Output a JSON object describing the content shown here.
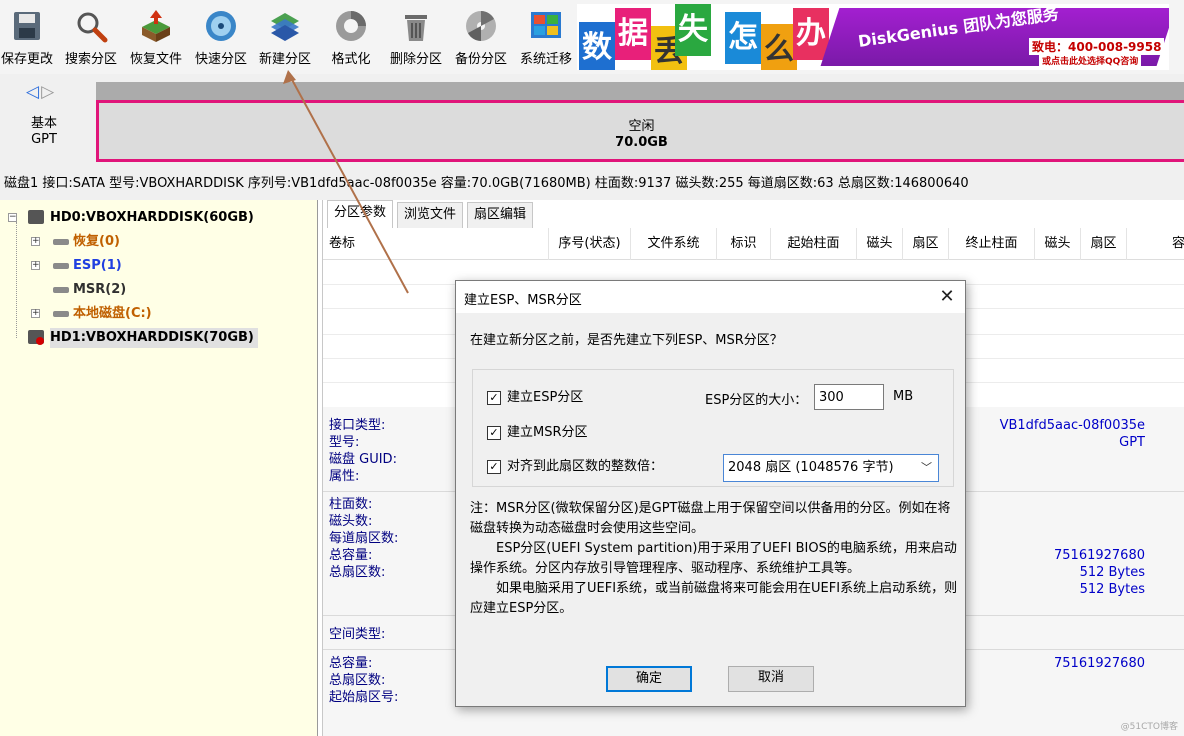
{
  "toolbar": {
    "buttons": [
      {
        "label": "保存更改",
        "icon": "save-icon"
      },
      {
        "label": "搜索分区",
        "icon": "search-icon"
      },
      {
        "label": "恢复文件",
        "icon": "recover-file-icon"
      },
      {
        "label": "快速分区",
        "icon": "quick-partition-icon"
      },
      {
        "label": "新建分区",
        "icon": "new-partition-icon"
      },
      {
        "label": "格式化",
        "icon": "format-icon"
      },
      {
        "label": "删除分区",
        "icon": "delete-partition-icon"
      },
      {
        "label": "备份分区",
        "icon": "backup-partition-icon"
      },
      {
        "label": "系统迁移",
        "icon": "system-migrate-icon"
      }
    ]
  },
  "banner": {
    "chars": [
      "数",
      "据",
      "丢",
      "失",
      "怎",
      "么",
      "办"
    ],
    "brand": "DiskGenius 团队为您服务",
    "phone": "致电：400-008-9958",
    "qq": "或点击此处选择QQ咨询"
  },
  "disk_map": {
    "type_label": "基本",
    "style_label": "GPT",
    "free_label": "空闲",
    "free_size": "70.0GB"
  },
  "disk_info": "磁盘1 接口:SATA  型号:VBOXHARDDISK  序列号:VB1dfd5aac-08f0035e  容量:70.0GB(71680MB)  柱面数:9137  磁头数:255  每道扇区数:63  总扇区数:146800640",
  "tree": {
    "disk0": "HD0:VBOXHARDDISK(60GB)",
    "partitions": [
      {
        "label": "恢复(0)",
        "color": "#c06000"
      },
      {
        "label": "ESP(1)",
        "color": "#2040e0"
      },
      {
        "label": "MSR(2)",
        "color": "#303030"
      },
      {
        "label": "本地磁盘(C:)",
        "color": "#c06000"
      }
    ],
    "disk1": "HD1:VBOXHARDDISK(70GB)"
  },
  "tabs": [
    "分区参数",
    "浏览文件",
    "扇区编辑"
  ],
  "grid": {
    "columns": [
      "卷标",
      "序号(状态)",
      "文件系统",
      "标识",
      "起始柱面",
      "磁头",
      "扇区",
      "终止柱面",
      "磁头",
      "扇区",
      "容"
    ]
  },
  "info": {
    "labels1": [
      "接口类型:",
      "型号:",
      "磁盘 GUID:",
      "属性:"
    ],
    "values1": [
      "VB1dfd5aac-08f0035e",
      "GPT"
    ],
    "labels2": [
      "柱面数:",
      "磁头数:",
      "每道扇区数:",
      "总容量:",
      "总扇区数:"
    ],
    "values2": [
      "75161927680",
      "512 Bytes",
      "512 Bytes"
    ],
    "label_space": "空间类型:",
    "labels3": [
      "总容量:",
      "总扇区数:",
      "起始扇区号:"
    ],
    "values3": [
      "75161927680"
    ]
  },
  "dialog": {
    "title": "建立ESP、MSR分区",
    "question": "在建立新分区之前，是否先建立下列ESP、MSR分区？",
    "chk_esp": "建立ESP分区",
    "chk_msr": "建立MSR分区",
    "chk_align": "对齐到此扇区数的整数倍：",
    "checked_mark": "✓",
    "esp_size_label": "ESP分区的大小：",
    "esp_size_value": "300",
    "esp_size_unit": "MB",
    "align_value": "2048 扇区 (1048576 字节)",
    "note": [
      "注：MSR分区(微软保留分区)是GPT磁盘上用于保留空间以供备用的分区。例如在将磁盘转换为动态磁盘时会使用这些空间。",
      "　　ESP分区(UEFI System partition)用于采用了UEFI BIOS的电脑系统，用来启动操作系统。分区内存放引导管理程序、驱动程序、系统维护工具等。",
      "　　如果电脑采用了UEFI系统，或当前磁盘将来可能会用在UEFI系统上启动系统，则应建立ESP分区。"
    ],
    "ok": "确定",
    "cancel": "取消"
  },
  "watermark": "@51CTO博客",
  "colors": {
    "accent": "#e0157a",
    "info_label": "#000080",
    "info_value": "#0000c8",
    "arrow": "#b0714a"
  }
}
